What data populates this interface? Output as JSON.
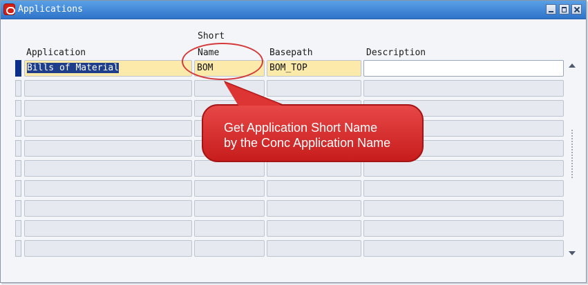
{
  "window": {
    "title": "Applications"
  },
  "headers": {
    "application": "Application",
    "short_name_line1": "Short",
    "short_name_line2": "Name",
    "basepath": "Basepath",
    "description": "Description"
  },
  "rows": [
    {
      "application": "Bills of Material",
      "short_name": "BOM",
      "basepath": "BOM_TOP",
      "description": ""
    },
    {
      "application": "",
      "short_name": "",
      "basepath": "",
      "description": ""
    },
    {
      "application": "",
      "short_name": "",
      "basepath": "",
      "description": ""
    },
    {
      "application": "",
      "short_name": "",
      "basepath": "",
      "description": ""
    },
    {
      "application": "",
      "short_name": "",
      "basepath": "",
      "description": ""
    },
    {
      "application": "",
      "short_name": "",
      "basepath": "",
      "description": ""
    },
    {
      "application": "",
      "short_name": "",
      "basepath": "",
      "description": ""
    },
    {
      "application": "",
      "short_name": "",
      "basepath": "",
      "description": ""
    },
    {
      "application": "",
      "short_name": "",
      "basepath": "",
      "description": ""
    },
    {
      "application": "",
      "short_name": "",
      "basepath": "",
      "description": ""
    }
  ],
  "callout": {
    "line1": "Get Application Short Name",
    "line2": "by the Conc Application Name"
  },
  "colors": {
    "callout_red": "#d62a2a",
    "active_field": "#fbeaaa",
    "title_bar": "#3a82d4"
  }
}
